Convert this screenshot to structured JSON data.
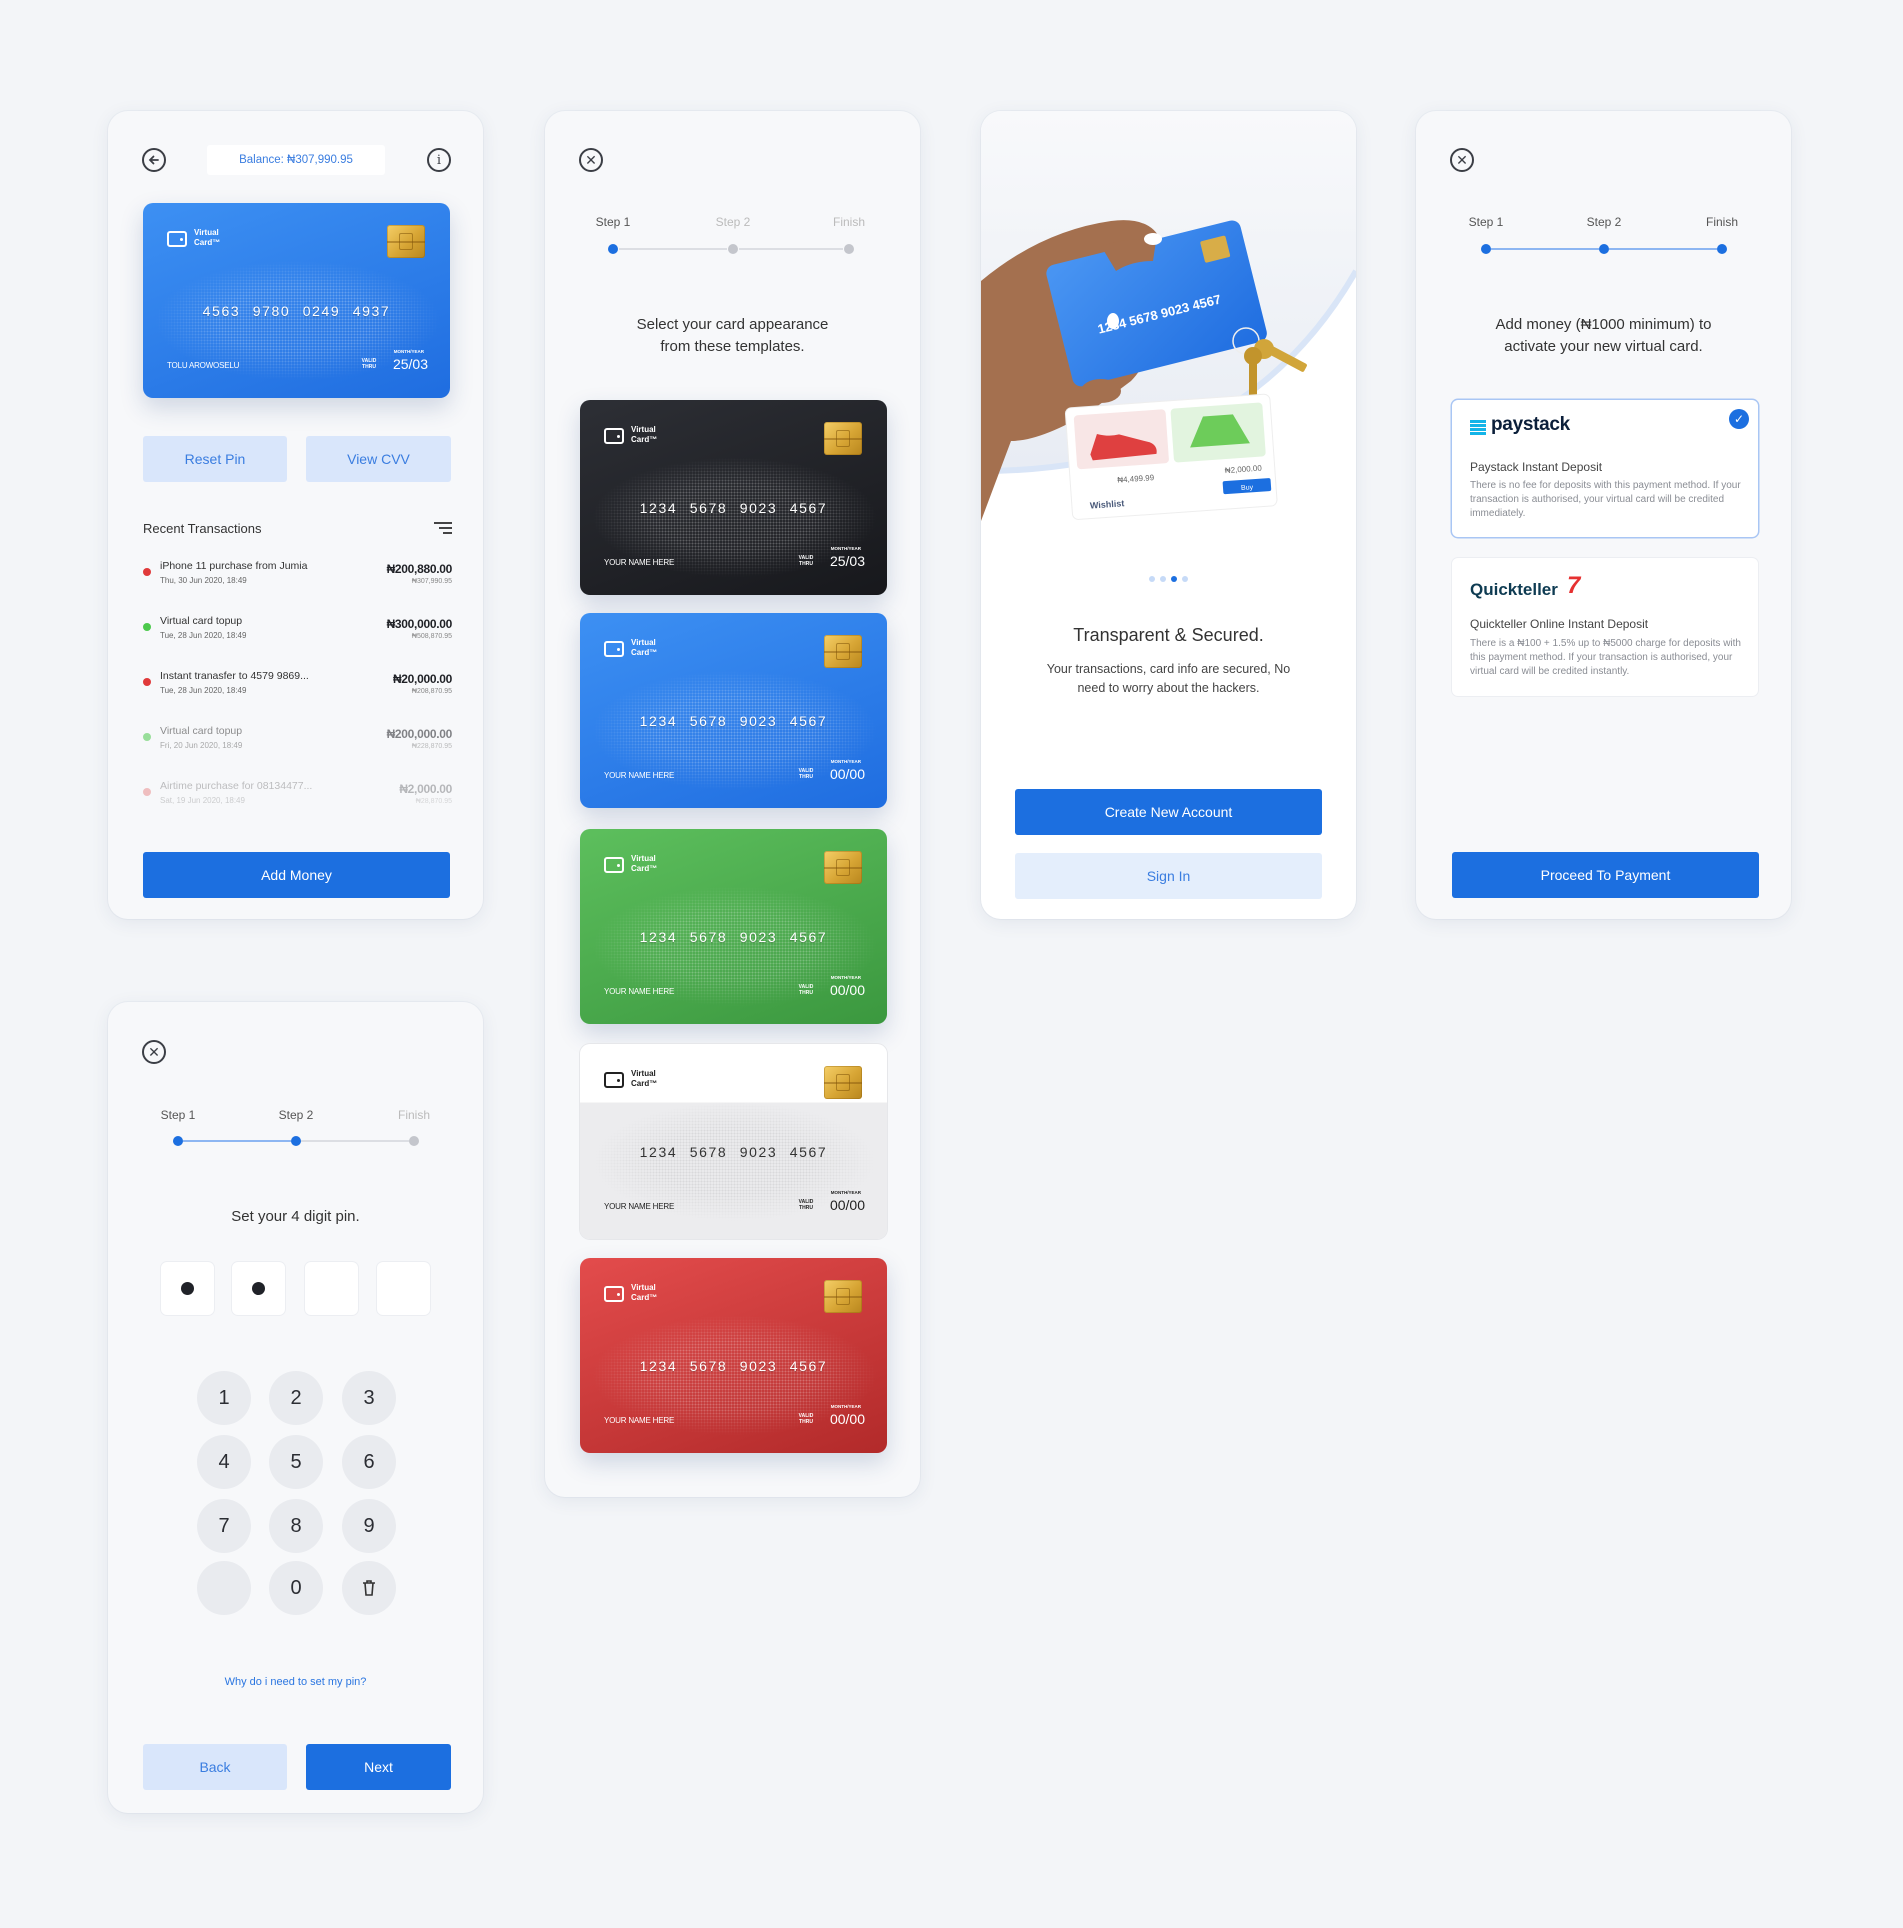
{
  "colors": {
    "page_bg": "#f3f5f8",
    "primary": "#1c6fe0",
    "primary_light": "#d9e6fb",
    "debit": "#e03a3a",
    "credit": "#4cc94c",
    "inactive": "#c4c6cc"
  },
  "card_brand": {
    "line1": "Virtual",
    "line2": "Card™",
    "valid_line1": "VALID",
    "valid_line2": "THRU",
    "month_year": "MONTH/YEAR"
  },
  "dashboard": {
    "balance": "Balance: ₦307,990.95",
    "card": {
      "theme": "blue",
      "number": "4563 9780 0249 4937",
      "holder": "TOLU AROWOSELU",
      "expiry": "25/03"
    },
    "reset_pin": "Reset Pin",
    "view_cvv": "View CVV",
    "recent_title": "Recent Transactions",
    "transactions": [
      {
        "title": "iPhone 11 purchase from Jumia",
        "date": "Thu, 30 Jun 2020, 18:49",
        "amount": "₦200,880.00",
        "balance": "₦307,990.95",
        "type": "debit"
      },
      {
        "title": "Virtual card topup",
        "date": "Tue, 28 Jun 2020, 18:49",
        "amount": "₦300,000.00",
        "balance": "₦508,870.95",
        "type": "credit"
      },
      {
        "title": "Instant tranasfer to 4579 9869...",
        "date": "Tue, 28 Jun 2020, 18:49",
        "amount": "₦20,000.00",
        "balance": "₦208,870.95",
        "type": "debit"
      },
      {
        "title": "Virtual card topup",
        "date": "Fri, 20 Jun 2020, 18:49",
        "amount": "₦200,000.00",
        "balance": "₦228,870.95",
        "type": "credit"
      },
      {
        "title": "Airtime purchase for 08134477...",
        "date": "Sat, 19 Jun 2020, 18:49",
        "amount": "₦2,000.00",
        "balance": "₦28,870.95",
        "type": "debit"
      }
    ],
    "add_money": "Add Money"
  },
  "steps": {
    "step1": "Step 1",
    "step2": "Step 2",
    "finish": "Finish"
  },
  "templates": {
    "line1": "Select your card appearance",
    "line2": "from these templates.",
    "cards": [
      {
        "theme": "black",
        "number": "1234 5678 9023 4567",
        "holder": "YOUR NAME HERE",
        "expiry": "25/03"
      },
      {
        "theme": "blue",
        "number": "1234 5678 9023 4567",
        "holder": "YOUR NAME HERE",
        "expiry": "00/00"
      },
      {
        "theme": "green",
        "number": "1234 5678 9023 4567",
        "holder": "YOUR NAME HERE",
        "expiry": "00/00"
      },
      {
        "theme": "white",
        "number": "1234 5678 9023 4567",
        "holder": "YOUR NAME HERE",
        "expiry": "00/00"
      },
      {
        "theme": "red",
        "number": "1234 5678 9023 4567",
        "holder": "YOUR NAME HERE",
        "expiry": "00/00"
      }
    ]
  },
  "onboarding": {
    "illustration": {
      "card_number": "1234 5678 9023 4567",
      "shoe_price": "₦4,499.99",
      "skirt_price": "₦2,000.00",
      "buy": "Buy",
      "wishlist": "Wishlist"
    },
    "carousel_total": 4,
    "carousel_active": 3,
    "title": "Transparent & Secured.",
    "desc_line1": "Your transactions, card info are secured, No",
    "desc_line2": "need to worry about the hackers.",
    "create_account": "Create New Account",
    "sign_in": "Sign In"
  },
  "payment": {
    "line1": "Add money (₦1000 minimum) to",
    "line2": "activate your new virtual card.",
    "methods": [
      {
        "logo": "paystack",
        "title": "Paystack Instant Deposit",
        "desc": "There is no fee for deposits with this payment method. If your transaction is authorised, your virtual card will be credited immediately.",
        "selected": true
      },
      {
        "logo": "Quickteller",
        "title": "Quickteller Online Instant Deposit",
        "desc": "There is a ₦100 + 1.5% up to ₦5000 charge for deposits with this payment method. If your transaction is authorised, your virtual card will be credited instantly.",
        "selected": false
      }
    ],
    "proceed": "Proceed To Payment"
  },
  "pin": {
    "title": "Set your 4 digit pin.",
    "digits_entered": 2,
    "digits_total": 4,
    "keys": [
      "1",
      "2",
      "3",
      "4",
      "5",
      "6",
      "7",
      "8",
      "9",
      "",
      "0",
      "delete-icon"
    ],
    "help_link": "Why do i need to set my pin?",
    "back": "Back",
    "next": "Next"
  }
}
